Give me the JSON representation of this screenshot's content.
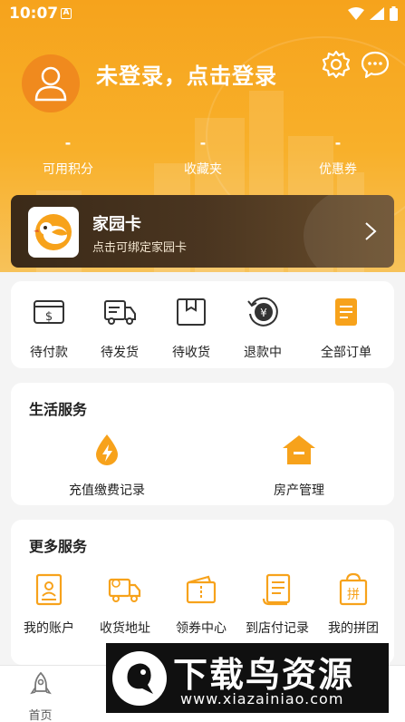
{
  "status_bar": {
    "time": "10:07",
    "notification_letter": "A"
  },
  "header": {
    "login_prompt": "未登录，点击登录",
    "stats": [
      {
        "value": "-",
        "label": "可用积分"
      },
      {
        "value": "-",
        "label": "收藏夹"
      },
      {
        "value": "-",
        "label": "优惠券"
      }
    ]
  },
  "home_card": {
    "title": "家园卡",
    "subtitle": "点击可绑定家园卡"
  },
  "orders": [
    {
      "label": "待付款",
      "icon": "wallet-icon"
    },
    {
      "label": "待发货",
      "icon": "delivery-truck-icon"
    },
    {
      "label": "待收货",
      "icon": "package-box-icon"
    },
    {
      "label": "退款中",
      "icon": "refund-yuan-icon"
    },
    {
      "label": "全部订单",
      "icon": "order-list-icon"
    }
  ],
  "life_services": {
    "title": "生活服务",
    "items": [
      {
        "label": "充值缴费记录",
        "icon": "recharge-drop-icon"
      },
      {
        "label": "房产管理",
        "icon": "house-icon"
      }
    ]
  },
  "more_services": {
    "title": "更多服务",
    "items": [
      {
        "label": "我的账户",
        "icon": "account-icon"
      },
      {
        "label": "收货地址",
        "icon": "shipping-truck-icon"
      },
      {
        "label": "领券中心",
        "icon": "coupon-wallet-icon"
      },
      {
        "label": "到店付记录",
        "icon": "receipt-scroll-icon"
      },
      {
        "label": "我的拼团",
        "icon": "group-buy-bag-icon"
      }
    ]
  },
  "tabbar": [
    {
      "label": "首页",
      "icon": "rocket-home-icon"
    }
  ],
  "watermark": {
    "title": "下载鸟资源",
    "url": "www.xiazainiao.com"
  },
  "colors": {
    "accent": "#f7a21b",
    "card_dark": "#3b2a18"
  }
}
